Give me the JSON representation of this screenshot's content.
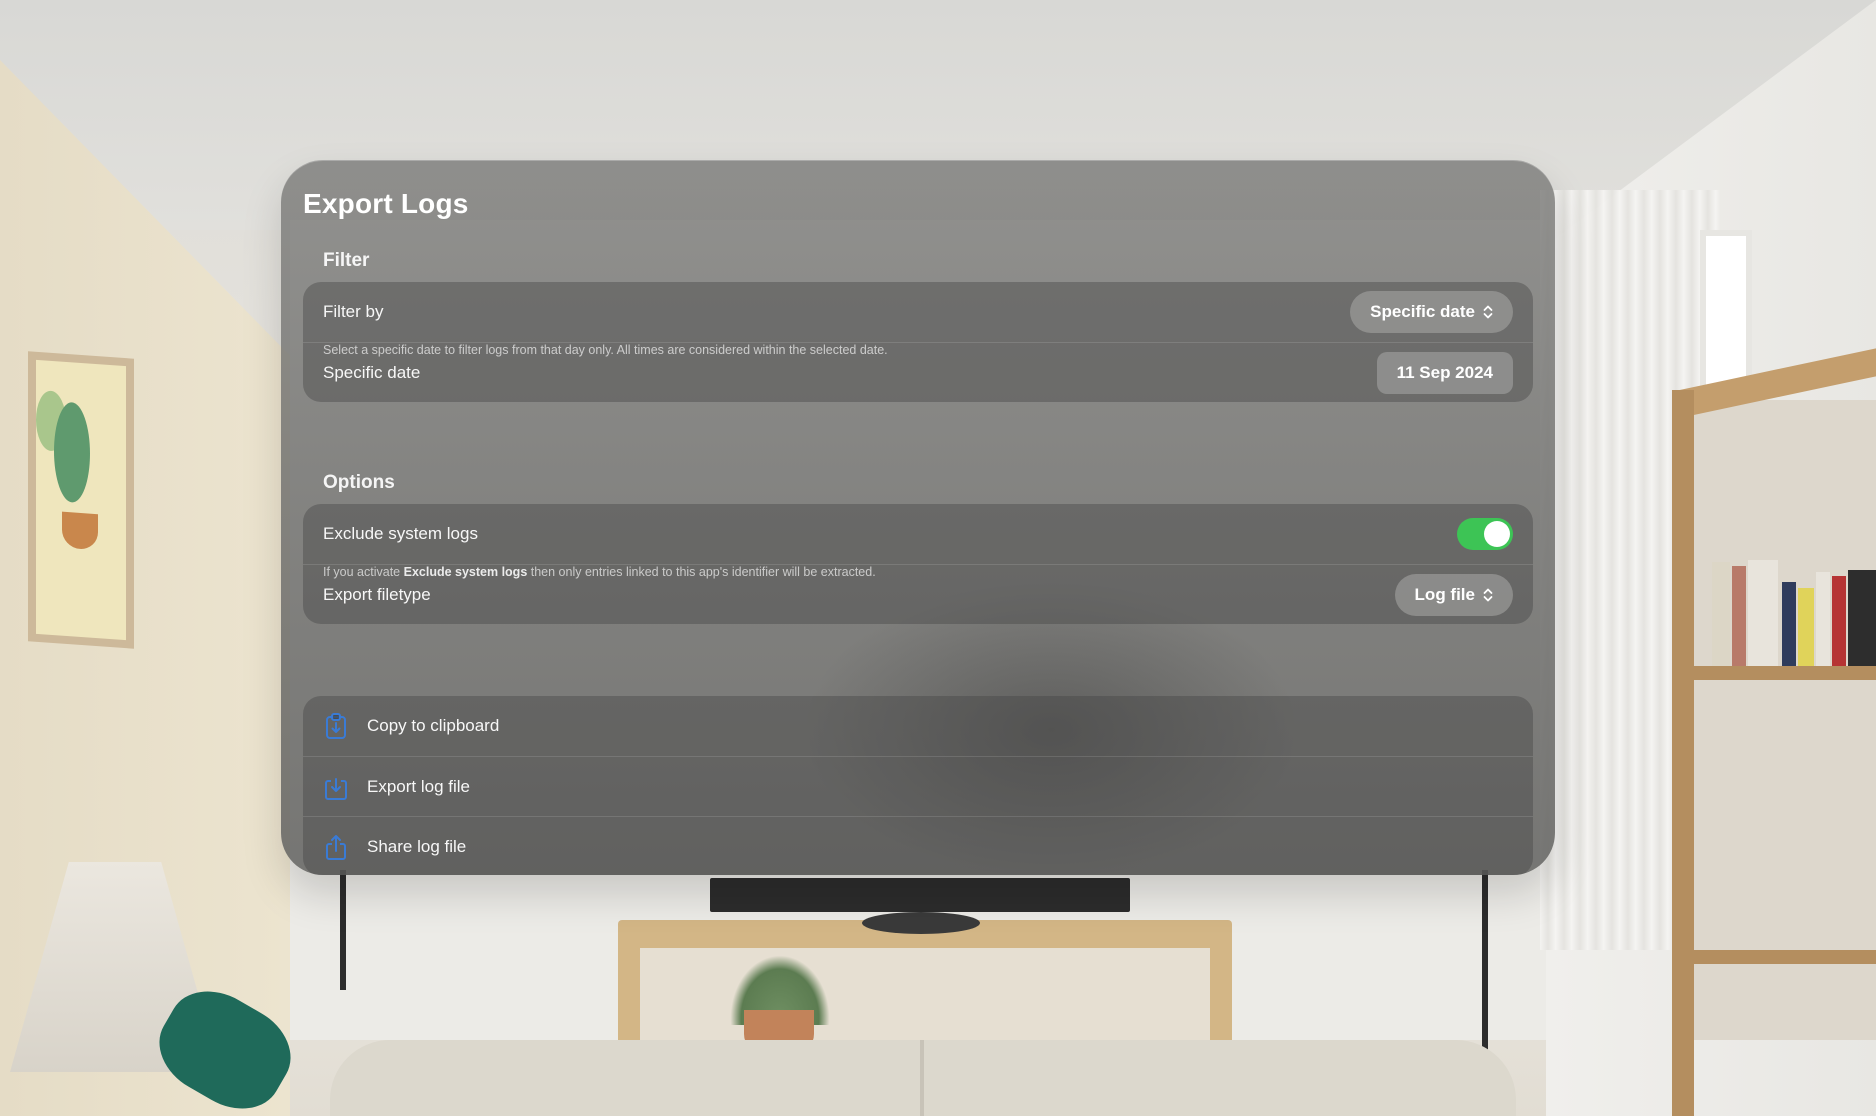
{
  "window": {
    "title": "Export Logs"
  },
  "filter_section": {
    "header": "Filter",
    "filter_by": {
      "label": "Filter by",
      "value": "Specific date"
    },
    "specific_date": {
      "label": "Specific date",
      "value": "11 Sep 2024"
    },
    "footnote": "Select a specific date to filter logs from that day only. All times are considered within the selected date."
  },
  "options_section": {
    "header": "Options",
    "exclude_system_logs": {
      "label": "Exclude system logs",
      "enabled": true
    },
    "export_filetype": {
      "label": "Export filetype",
      "value": "Log file"
    },
    "footnote": {
      "prefix": "If you activate ",
      "bold": "Exclude system logs",
      "suffix": " then only entries linked to this app's identifier will be extracted."
    }
  },
  "actions": [
    {
      "label": "Copy to clipboard",
      "icon": "clipboard-icon"
    },
    {
      "label": "Export log file",
      "icon": "export-icon"
    },
    {
      "label": "Share log file",
      "icon": "share-icon"
    }
  ],
  "colors": {
    "toggle_on": "#3dc455",
    "icon_accent": "#3a7bd5"
  }
}
